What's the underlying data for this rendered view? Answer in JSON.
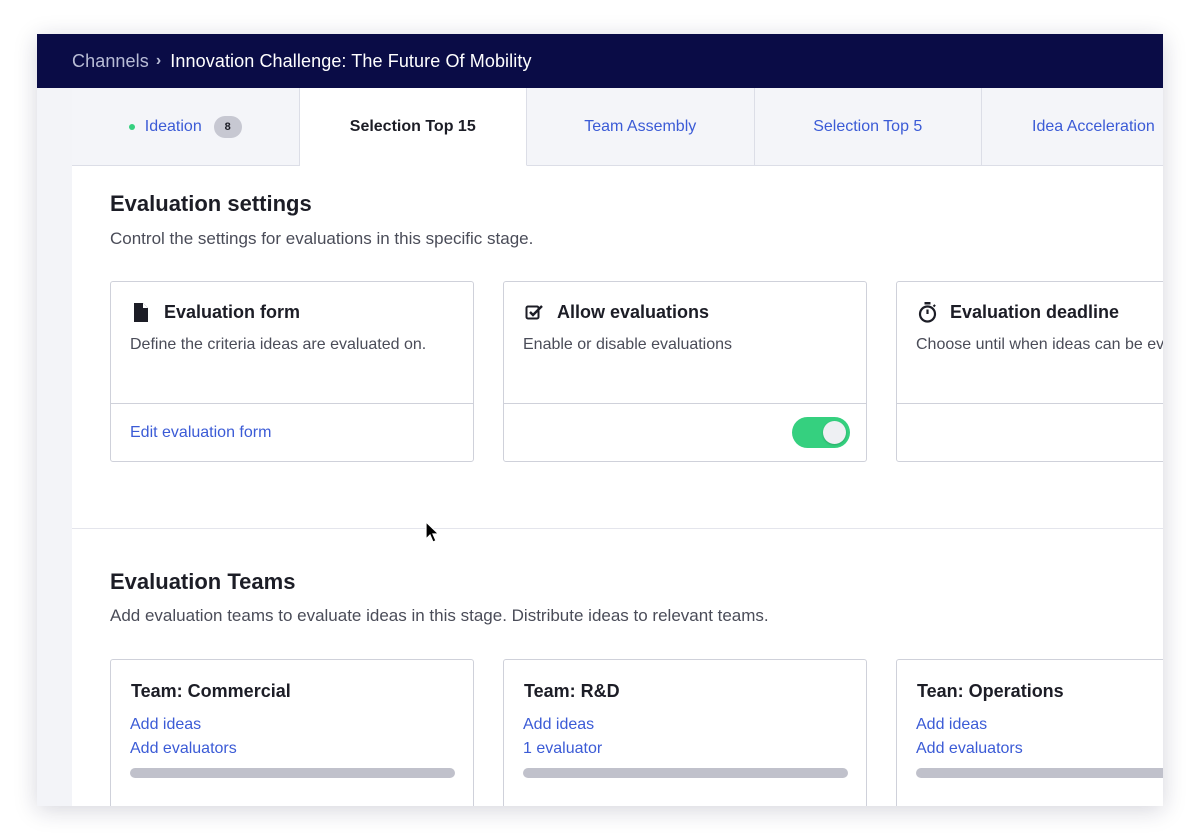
{
  "breadcrumb": {
    "root": "Channels",
    "separator": "›",
    "current": "Innovation Challenge: The Future Of Mobility"
  },
  "tabs": [
    {
      "label": "Ideation",
      "badge": "8",
      "status_dot": true
    },
    {
      "label": "Selection Top 15",
      "active": true
    },
    {
      "label": "Team Assembly"
    },
    {
      "label": "Selection Top 5"
    },
    {
      "label": "Idea Acceleration"
    }
  ],
  "evaluation_settings": {
    "title": "Evaluation settings",
    "subtitle": "Control the settings for evaluations in this specific stage.",
    "cards": [
      {
        "icon": "document-icon",
        "title": "Evaluation form",
        "description": "Define the criteria ideas are evaluated on.",
        "action": "Edit evaluation form"
      },
      {
        "icon": "checkbox-icon",
        "title": "Allow evaluations",
        "description": "Enable or disable evaluations",
        "toggle_on": true
      },
      {
        "icon": "stopwatch-icon",
        "title": "Evaluation deadline",
        "description": "Choose until when ideas can be evaluated"
      }
    ]
  },
  "evaluation_teams": {
    "title": "Evaluation Teams",
    "subtitle": "Add evaluation teams to evaluate ideas in this stage. Distribute ideas to relevant teams.",
    "teams": [
      {
        "title": "Team: Commercial",
        "ideas_link": "Add ideas",
        "evaluators_link": "Add evaluators"
      },
      {
        "title": "Team: R&D",
        "ideas_link": "Add ideas",
        "evaluators_link": "1 evaluator"
      },
      {
        "title": "Tean: Operations",
        "ideas_link": "Add ideas",
        "evaluators_link": "Add evaluators"
      }
    ]
  },
  "colors": {
    "header_bg": "#0a0c46",
    "link": "#3b5bd6",
    "toggle_on": "#35d07f",
    "status_dot": "#35d07f"
  }
}
